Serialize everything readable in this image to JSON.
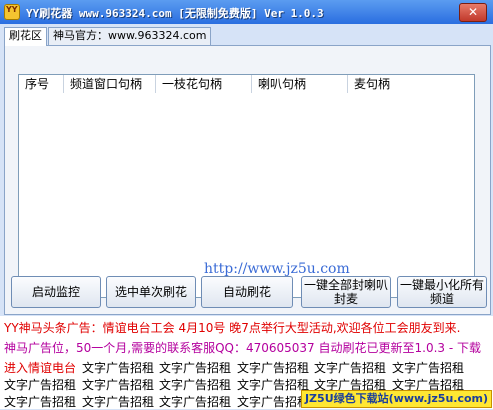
{
  "window": {
    "title": "YY刷花器  www.963324.com [无限制免费版] Ver 1.0.3",
    "close_glyph": "✕"
  },
  "tabs": [
    {
      "label": "刷花区",
      "active": true
    },
    {
      "label": "神马官方：www.963324.com",
      "active": false
    }
  ],
  "list": {
    "columns": [
      "序号",
      "频道窗口句柄",
      "一枝花句柄",
      "喇叭句柄",
      "麦句柄"
    ],
    "rows": [],
    "watermark": "http://www.jz5u.com"
  },
  "buttons": {
    "start_monitor": "启动监控",
    "select_single": "选中单次刷花",
    "auto_flower": "自动刷花",
    "ban_all_line1": "一键全部封喇叭",
    "ban_all_line2": "封麦",
    "minimize_all_line1": "一键最小化所有",
    "minimize_all_line2": "频道"
  },
  "ads": {
    "line1": "YY神马头条广告：情谊电台工会 4月10号 晚7点举行大型活动,欢迎各位工会朋友到来.",
    "line2": "神马广告位，50一个月,需要的联系客服QQ：470605037 自动刷花已更新至1.0.3 - 下载",
    "line3_lead": "进入情谊电台",
    "placeholder": "文字广告招租",
    "jz5u_badge": "JZ5U绿色下载站(www.jz5u.com)"
  },
  "colors": {
    "title_bar": "#2a6ee0",
    "ad_red": "#e00000",
    "ad_purple": "#b4009e",
    "watermark_blue": "#3a6bd6"
  }
}
